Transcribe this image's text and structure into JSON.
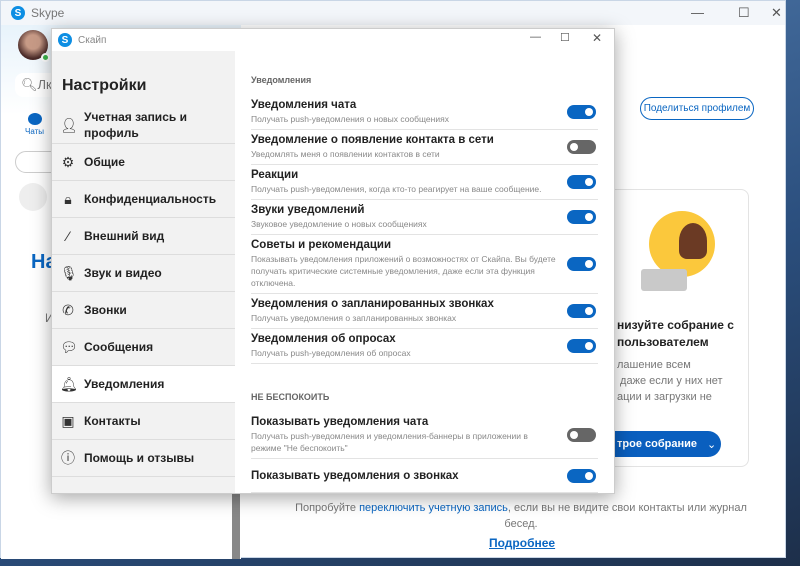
{
  "main_window": {
    "title": "Skype",
    "search_partial": "Лк",
    "chats_label": "Чаты",
    "heading_partial": "На",
    "text_partial": "И",
    "share_profile": "Поделиться профилем",
    "card_title": "низуйте собрание с\nпользователем",
    "card_text": "лашение всем\n даже если у них нет\nации и загрузки не",
    "meet_button": "трое собрание",
    "hint_before": "Попробуйте ",
    "hint_link": "переключить учетную запись",
    "hint_after": ", если вы не видите свои контакты или журнал бесед.",
    "more_link": "Подробнее"
  },
  "dialog": {
    "title": "Скайп",
    "heading": "Настройки",
    "nav": [
      {
        "label": "Учетная запись и профиль",
        "icon": "person-icon"
      },
      {
        "label": "Общие",
        "icon": "gear-icon"
      },
      {
        "label": "Конфиденциальность",
        "icon": "lock-icon"
      },
      {
        "label": "Внешний вид",
        "icon": "wand-icon"
      },
      {
        "label": "Звук и видео",
        "icon": "microphone-icon"
      },
      {
        "label": "Звонки",
        "icon": "phone-icon"
      },
      {
        "label": "Сообщения",
        "icon": "chat-icon"
      },
      {
        "label": "Уведомления",
        "icon": "bell-icon",
        "active": true
      },
      {
        "label": "Контакты",
        "icon": "contacts-icon"
      },
      {
        "label": "Помощь и отзывы",
        "icon": "info-icon"
      }
    ],
    "section1": "Уведомления",
    "items1": [
      {
        "label": "Уведомления чата",
        "desc": "Получать push-уведомления о новых сообщениях",
        "on": true
      },
      {
        "label": "Уведомление о появление контакта в сети",
        "desc": "Уведомлять меня о появлении контактов в сети",
        "on": false
      },
      {
        "label": "Реакции",
        "desc": "Получать push-уведомления, когда кто-то реагирует на ваше сообщение.",
        "on": true
      },
      {
        "label": "Звуки уведомлений",
        "desc": "Звуковое уведомление о новых сообщениях",
        "on": true
      },
      {
        "label": "Советы и рекомендации",
        "desc": "Показывать уведомления приложений о возможностях от Скайпа. Вы будете получать критические системные уведомления, даже если эта функция отключена.",
        "on": true
      },
      {
        "label": "Уведомления о запланированных звонках",
        "desc": "Получать уведомления о запланированных звонках",
        "on": true
      },
      {
        "label": "Уведомления об опросах",
        "desc": "Получать push-уведомления об опросах",
        "on": true
      }
    ],
    "section2": "НЕ БЕСПОКОИТЬ",
    "items2": [
      {
        "label": "Показывать уведомления чата",
        "desc": "Получать push-уведомления и уведомления-баннеры в приложении в режиме \"Не беспокоить\"",
        "on": false
      },
      {
        "label": "Показывать уведомления о звонках",
        "desc": "",
        "on": true
      }
    ]
  },
  "colors": {
    "accent": "#0a66c2",
    "toggle_off": "#666666"
  }
}
